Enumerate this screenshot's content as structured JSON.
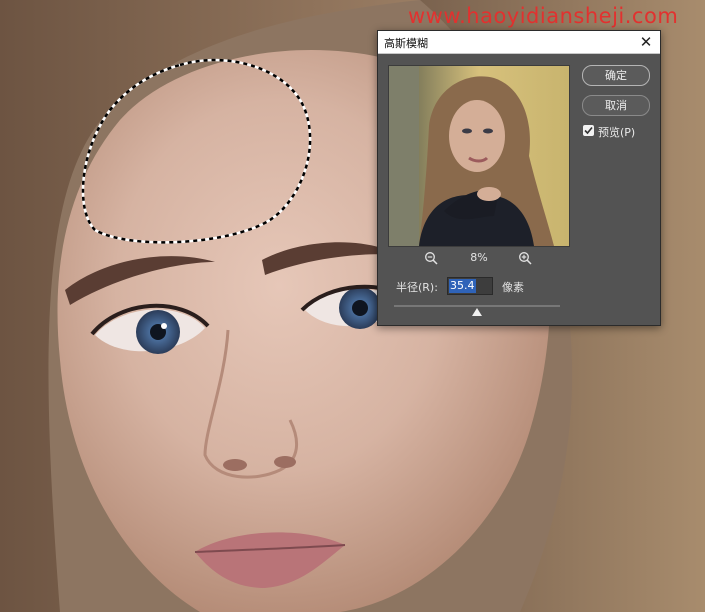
{
  "watermark": "www.haoyidiansheji.com",
  "dialog": {
    "title": "高斯模糊",
    "close_label": "✕",
    "ok_label": "确定",
    "cancel_label": "取消",
    "preview_label": "预览(P)",
    "preview_checked": true,
    "zoom_level": "8%",
    "radius_label": "半径(R):",
    "radius_value": "35.4",
    "radius_unit": "像素"
  },
  "colors": {
    "dialog_bg": "#535353",
    "highlight": "#2f63b8",
    "watermark": "#e2312f"
  },
  "icons": [
    "zoom-out-icon",
    "zoom-in-icon",
    "close-icon",
    "checkmark-icon"
  ]
}
